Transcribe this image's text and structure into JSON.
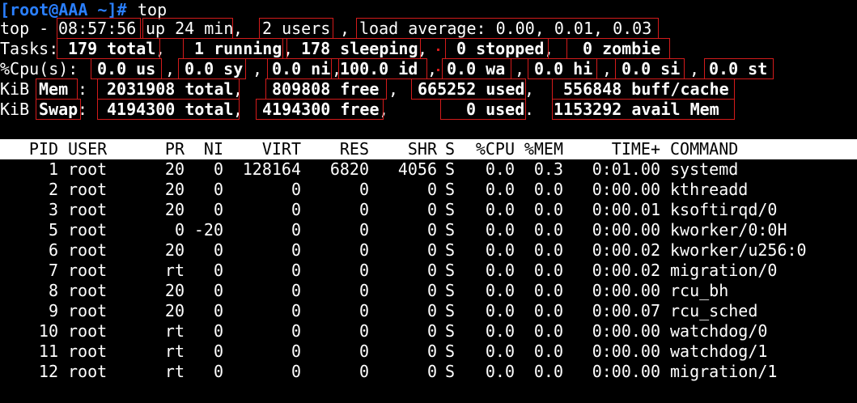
{
  "prompt": {
    "text": "[root@AAA ~]#",
    "command": "top"
  },
  "summary": {
    "top_prefix": "top -",
    "time": "08:57:56",
    "uptime": "up 24 min",
    "users": "2 users",
    "load": "load average: 0.00, 0.01, 0.03",
    "tasks_label": "Tasks:",
    "tasks_total": "179 total",
    "running": "1 running",
    "sleeping": "178 sleeping",
    "stopped": "0 stopped",
    "zombie": "0 zombie",
    "cpu_label": "%Cpu(s):",
    "cpu": [
      "0.0 us",
      "0.0 sy",
      "0.0 ni",
      "100.0 id",
      "0.0 wa",
      "0.0 hi",
      "0.0 si",
      "0.0 st"
    ],
    "kib": "KiB",
    "mem_label": "Mem",
    "mem_total": "2031908 total",
    "mem_free": "809808 free",
    "mem_used": "665252 used",
    "mem_buff": "556848 buff/cache",
    "swap_label": "Swap",
    "swap_total": "4194300 total",
    "swap_free": "4194300 free",
    "swap_used": "0 used",
    "avail_mem": "1153292 avail Mem"
  },
  "table": {
    "headers": [
      "PID",
      "USER",
      "PR",
      "NI",
      "VIRT",
      "RES",
      "SHR",
      "S",
      "%CPU",
      "%MEM",
      "TIME+",
      "COMMAND"
    ],
    "rows": [
      [
        "1",
        "root",
        "20",
        "0",
        "128164",
        "6820",
        "4056",
        "S",
        "0.0",
        "0.3",
        "0:01.00",
        "systemd"
      ],
      [
        "2",
        "root",
        "20",
        "0",
        "0",
        "0",
        "0",
        "S",
        "0.0",
        "0.0",
        "0:00.00",
        "kthreadd"
      ],
      [
        "3",
        "root",
        "20",
        "0",
        "0",
        "0",
        "0",
        "S",
        "0.0",
        "0.0",
        "0:00.01",
        "ksoftirqd/0"
      ],
      [
        "5",
        "root",
        "0",
        "-20",
        "0",
        "0",
        "0",
        "S",
        "0.0",
        "0.0",
        "0:00.00",
        "kworker/0:0H"
      ],
      [
        "6",
        "root",
        "20",
        "0",
        "0",
        "0",
        "0",
        "S",
        "0.0",
        "0.0",
        "0:00.02",
        "kworker/u256:0"
      ],
      [
        "7",
        "root",
        "rt",
        "0",
        "0",
        "0",
        "0",
        "S",
        "0.0",
        "0.0",
        "0:00.02",
        "migration/0"
      ],
      [
        "8",
        "root",
        "20",
        "0",
        "0",
        "0",
        "0",
        "S",
        "0.0",
        "0.0",
        "0:00.00",
        "rcu_bh"
      ],
      [
        "9",
        "root",
        "20",
        "0",
        "0",
        "0",
        "0",
        "S",
        "0.0",
        "0.0",
        "0:00.07",
        "rcu_sched"
      ],
      [
        "10",
        "root",
        "rt",
        "0",
        "0",
        "0",
        "0",
        "S",
        "0.0",
        "0.0",
        "0:00.00",
        "watchdog/0"
      ],
      [
        "11",
        "root",
        "rt",
        "0",
        "0",
        "0",
        "0",
        "S",
        "0.0",
        "0.0",
        "0:00.00",
        "watchdog/1"
      ],
      [
        "12",
        "root",
        "rt",
        "0",
        "0",
        "0",
        "0",
        "S",
        "0.0",
        "0.0",
        "0:00.00",
        "migration/1"
      ]
    ]
  },
  "colors": {
    "prompt": "#2a7fff",
    "annotation_box": "#d31b1b",
    "background": "#000000",
    "text": "#ffffff"
  }
}
